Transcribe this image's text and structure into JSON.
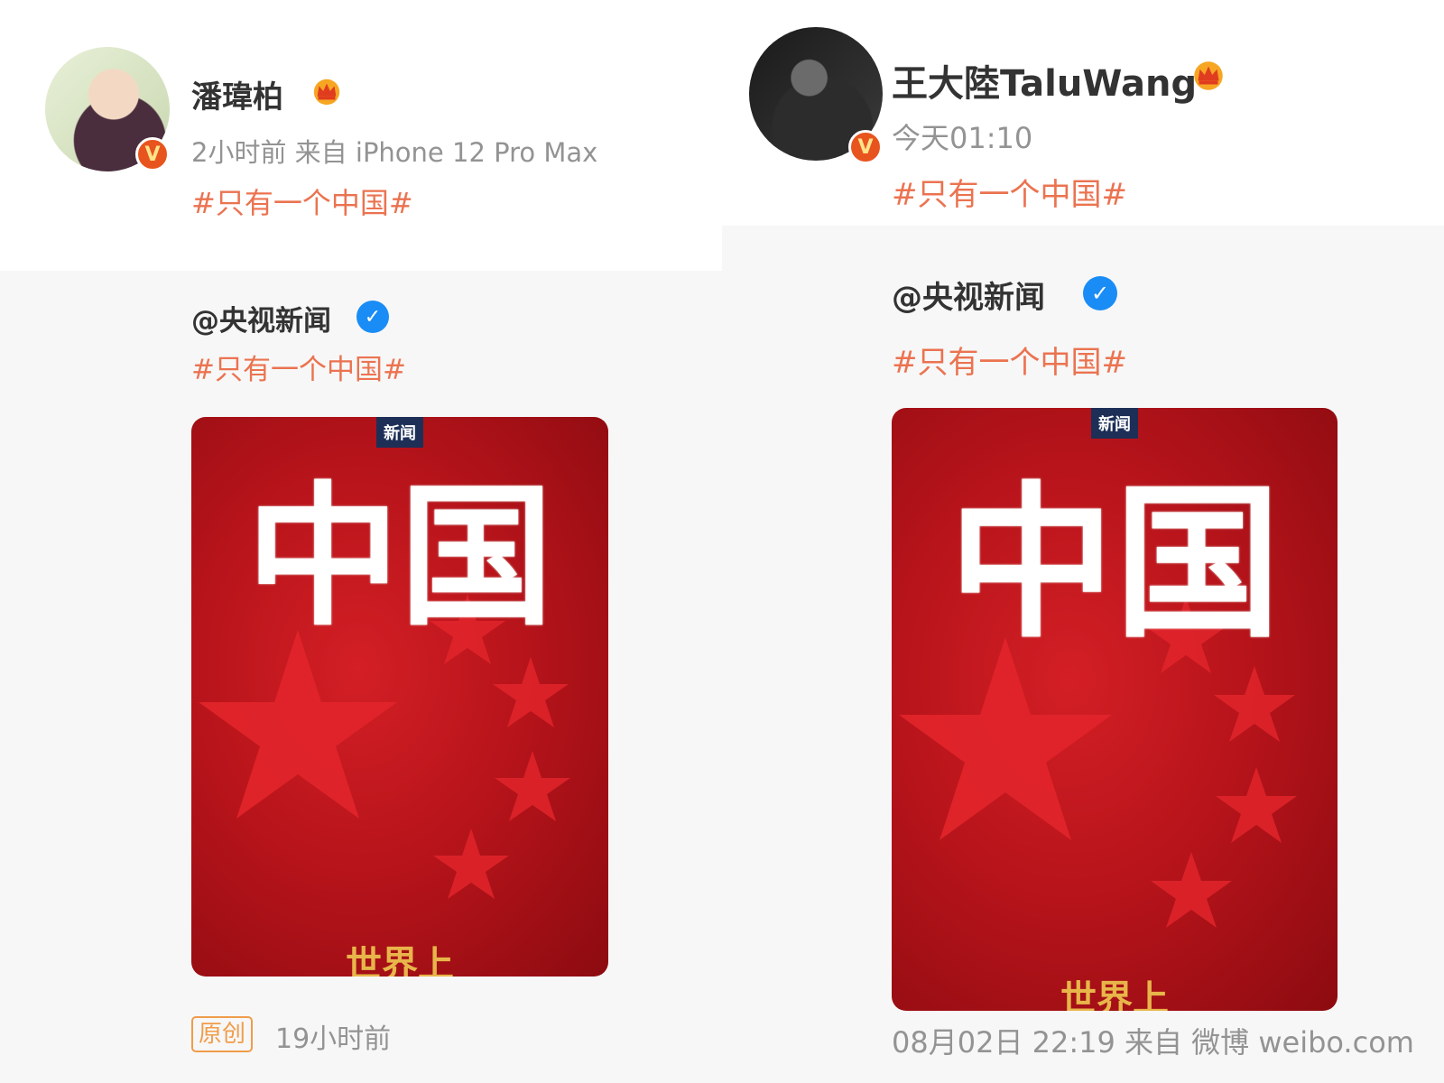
{
  "posts": [
    {
      "author": "潘瑋柏",
      "meta": "2小时前  来自 iPhone 12 Pro Max",
      "hashtag": "#只有一个中国#",
      "repost": {
        "author": "@央视新闻",
        "hashtag": "#只有一个中国#",
        "poster": {
          "logo": "新闻",
          "title": "中国",
          "subtitle": "世界上"
        },
        "badge": "原创",
        "time": "19小时前"
      }
    },
    {
      "author": "王大陸TaluWang",
      "meta": "今天01:10",
      "hashtag": "#只有一个中国#",
      "repost": {
        "author": "@央视新闻",
        "hashtag": "#只有一个中国#",
        "poster": {
          "logo": "新闻",
          "title": "中国",
          "subtitle": "世界上"
        },
        "time": "08月02日 22:19 来自 微博 weibo.com"
      }
    }
  ],
  "icons": {
    "verified_badge": "v-icon",
    "crown": "crown-icon",
    "blue_verified": "blue-v-icon",
    "v_letter": "V",
    "blue_v_letter": "✓"
  },
  "colors": {
    "hashtag": "#eb7350",
    "meta": "#939393",
    "verified_orange": "#e8541e",
    "blue_verified": "#1a8cf5",
    "poster_red": "#c8181f"
  }
}
